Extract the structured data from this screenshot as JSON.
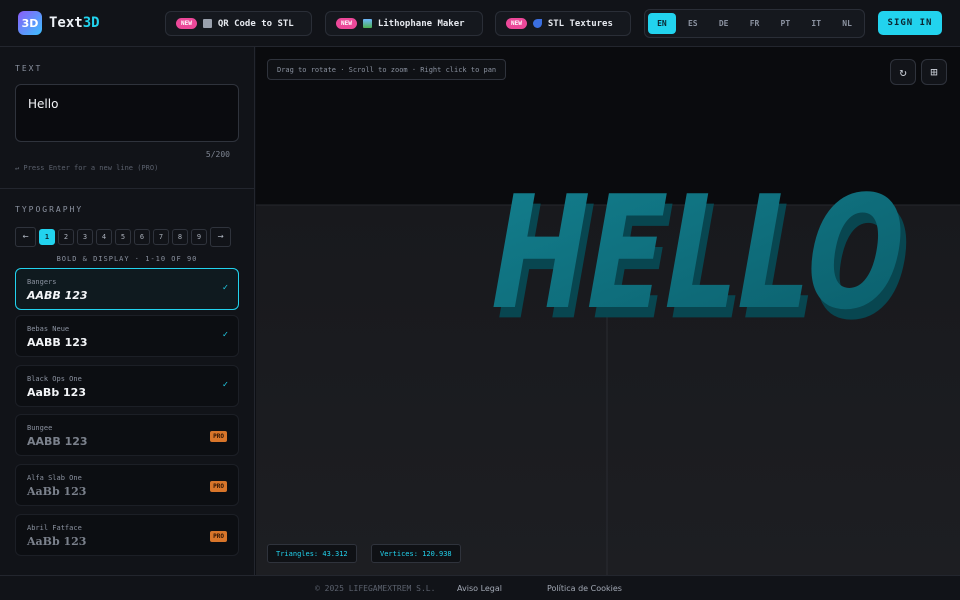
{
  "header": {
    "logo_icon": "3D",
    "logo_text_1": "Text",
    "logo_text_2": "3D",
    "pills": [
      {
        "badge": "NEW",
        "label": "QR Code to STL",
        "icon": "qr-icon"
      },
      {
        "badge": "NEW",
        "label": "Lithophane Maker",
        "icon": "image-icon"
      },
      {
        "badge": "NEW",
        "label": "STL Textures",
        "icon": "texture-icon"
      }
    ],
    "languages": [
      "EN",
      "ES",
      "DE",
      "FR",
      "PT",
      "IT",
      "NL"
    ],
    "active_language": "EN",
    "signin_label": "SIGN IN"
  },
  "sidebar": {
    "text_label": "TEXT",
    "text_value": "Hello",
    "counter": "5/200",
    "hint": "↵ Press Enter for a new line (PRO)",
    "typography_label": "TYPOGRAPHY",
    "pager": {
      "prev": "←",
      "next": "→",
      "pages": [
        "1",
        "2",
        "3",
        "4",
        "5",
        "6",
        "7",
        "8",
        "9"
      ],
      "active": "1"
    },
    "group_label": "BOLD & DISPLAY · 1-10 OF 90",
    "fonts": [
      {
        "name": "Bangers",
        "sample": "AABB 123",
        "status": "check"
      },
      {
        "name": "Bebas Neue",
        "sample": "AABB 123",
        "status": "check"
      },
      {
        "name": "Black Ops One",
        "sample": "AaBb 123",
        "status": "check"
      },
      {
        "name": "Bungee",
        "sample": "AABB 123",
        "status": "PRO"
      },
      {
        "name": "Alfa Slab One",
        "sample": "AaBb 123",
        "status": "PRO"
      },
      {
        "name": "Abril Fatface",
        "sample": "AaBb 123",
        "status": "PRO"
      }
    ]
  },
  "viewport": {
    "hint": "Drag to rotate · Scroll to zoom · Right click to pan",
    "model_text": "HELLO",
    "triangles": "Triangles: 43.312",
    "vertices": "Vertices: 120.938",
    "accent": "#22d3ee",
    "model_color": "#0e6f7d"
  },
  "footer": {
    "copyright": "© 2025 LIFEGAMEXTREM S.L.",
    "links": [
      "Aviso Legal",
      "Política de Cookies"
    ]
  }
}
